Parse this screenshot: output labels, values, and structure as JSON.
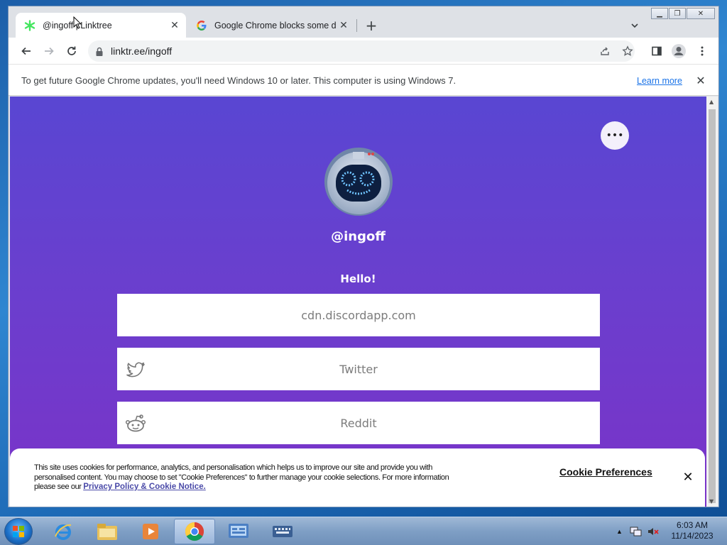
{
  "browser": {
    "tabs": [
      {
        "title": "@ingoff | Linktree",
        "active": true
      },
      {
        "title": "Google Chrome blocks some do",
        "active": false
      }
    ],
    "url": "linktr.ee/ingoff",
    "infobar": {
      "message": "To get future Google Chrome updates, you'll need Windows 10 or later. This computer is using Windows 7.",
      "learn_more": "Learn more"
    }
  },
  "profile": {
    "handle": "@ingoff",
    "bio": "Hello!"
  },
  "links": [
    {
      "label": "cdn.discordapp.com",
      "icon": ""
    },
    {
      "label": "Twitter",
      "icon": "twitter-icon"
    },
    {
      "label": "Reddit",
      "icon": "reddit-icon"
    }
  ],
  "cookie_banner": {
    "text": "This site uses cookies for performance, analytics, and personalisation which helps us to improve our site and provide you with personalised content. You may choose to set \"Cookie Preferences\" to further manage your cookie selections. For more information please see our",
    "policy_link": "Privacy Policy & Cookie Notice.",
    "preferences": "Cookie Preferences"
  },
  "taskbar": {
    "time": "6:03 AM",
    "date": "11/14/2023"
  },
  "colors": {
    "gradient_top": "#5946d2",
    "gradient_bottom": "#7a33c8",
    "link_text": "#1a73e8"
  }
}
